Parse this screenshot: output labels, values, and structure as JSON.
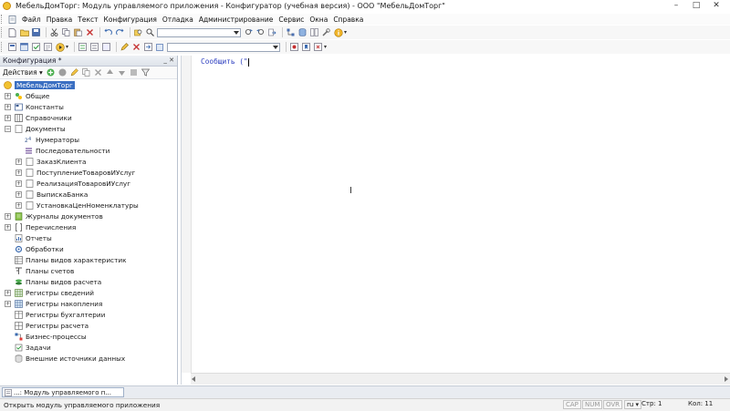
{
  "window": {
    "title": "МебельДомТорг: Модуль управляемого приложения - Конфигуратор (учебная версия) - ООО \"МебельДомТорг\"",
    "controls": [
      "–",
      "□",
      "✕"
    ]
  },
  "menu": {
    "items": [
      "Файл",
      "Правка",
      "Текст",
      "Конфигурация",
      "Отладка",
      "Администрирование",
      "Сервис",
      "Окна",
      "Справка"
    ]
  },
  "toolbar": {
    "search_value": "",
    "second_combo_value": ""
  },
  "panel": {
    "title": "Конфигурация *",
    "header_buttons": "_ ✕",
    "actions_label": "Действия ▾"
  },
  "tree": [
    {
      "label": "МебельДомТорг",
      "level": 0,
      "expander": "",
      "icon": "app-icon",
      "selected": true
    },
    {
      "label": "Общие",
      "level": 0,
      "expander": "+",
      "icon": "common-icon"
    },
    {
      "label": "Константы",
      "level": 0,
      "expander": "+",
      "icon": "constants-icon"
    },
    {
      "label": "Справочники",
      "level": 0,
      "expander": "+",
      "icon": "catalogs-icon"
    },
    {
      "label": "Документы",
      "level": 0,
      "expander": "−",
      "icon": "documents-icon"
    },
    {
      "label": "Нумераторы",
      "level": 1,
      "expander": "",
      "icon": "numerators-icon"
    },
    {
      "label": "Последовательности",
      "level": 1,
      "expander": "",
      "icon": "sequences-icon"
    },
    {
      "label": "ЗаказКлиента",
      "level": 1,
      "expander": "+",
      "icon": "document-icon"
    },
    {
      "label": "ПоступлениеТоваровИУслуг",
      "level": 1,
      "expander": "+",
      "icon": "document-icon"
    },
    {
      "label": "РеализацияТоваровИУслуг",
      "level": 1,
      "expander": "+",
      "icon": "document-icon"
    },
    {
      "label": "ВыпискаБанка",
      "level": 1,
      "expander": "+",
      "icon": "document-icon"
    },
    {
      "label": "УстановкаЦенНоменклатуры",
      "level": 1,
      "expander": "+",
      "icon": "document-icon"
    },
    {
      "label": "Журналы документов",
      "level": 0,
      "expander": "+",
      "icon": "journals-icon"
    },
    {
      "label": "Перечисления",
      "level": 0,
      "expander": "+",
      "icon": "enums-icon"
    },
    {
      "label": "Отчеты",
      "level": 0,
      "expander": "",
      "icon": "reports-icon"
    },
    {
      "label": "Обработки",
      "level": 0,
      "expander": "",
      "icon": "processing-icon"
    },
    {
      "label": "Планы видов характеристик",
      "level": 0,
      "expander": "",
      "icon": "char-plans-icon"
    },
    {
      "label": "Планы счетов",
      "level": 0,
      "expander": "",
      "icon": "accounts-icon"
    },
    {
      "label": "Планы видов расчета",
      "level": 0,
      "expander": "",
      "icon": "calc-plans-icon"
    },
    {
      "label": "Регистры сведений",
      "level": 0,
      "expander": "+",
      "icon": "info-registers-icon"
    },
    {
      "label": "Регистры накопления",
      "level": 0,
      "expander": "+",
      "icon": "accum-registers-icon"
    },
    {
      "label": "Регистры бухгалтерии",
      "level": 0,
      "expander": "",
      "icon": "accounting-registers-icon"
    },
    {
      "label": "Регистры расчета",
      "level": 0,
      "expander": "",
      "icon": "calc-registers-icon"
    },
    {
      "label": "Бизнес-процессы",
      "level": 0,
      "expander": "",
      "icon": "business-process-icon"
    },
    {
      "label": "Задачи",
      "level": 0,
      "expander": "",
      "icon": "tasks-icon"
    },
    {
      "label": "Внешние источники данных",
      "level": 0,
      "expander": "",
      "icon": "external-sources-icon"
    }
  ],
  "editor": {
    "code": "Сообщить (\""
  },
  "tabs": [
    {
      "label": "...: Модуль управляемого п..."
    }
  ],
  "status": {
    "text": "Открыть модуль управляемого приложения",
    "cap": "CAP",
    "num": "NUM",
    "ovr": "OVR",
    "lang": "ru ▾",
    "line": "Стр: 1",
    "col": "Кол: 11"
  },
  "colors": {
    "accent": "#3b6fc2",
    "code": "#2d3fc0"
  }
}
